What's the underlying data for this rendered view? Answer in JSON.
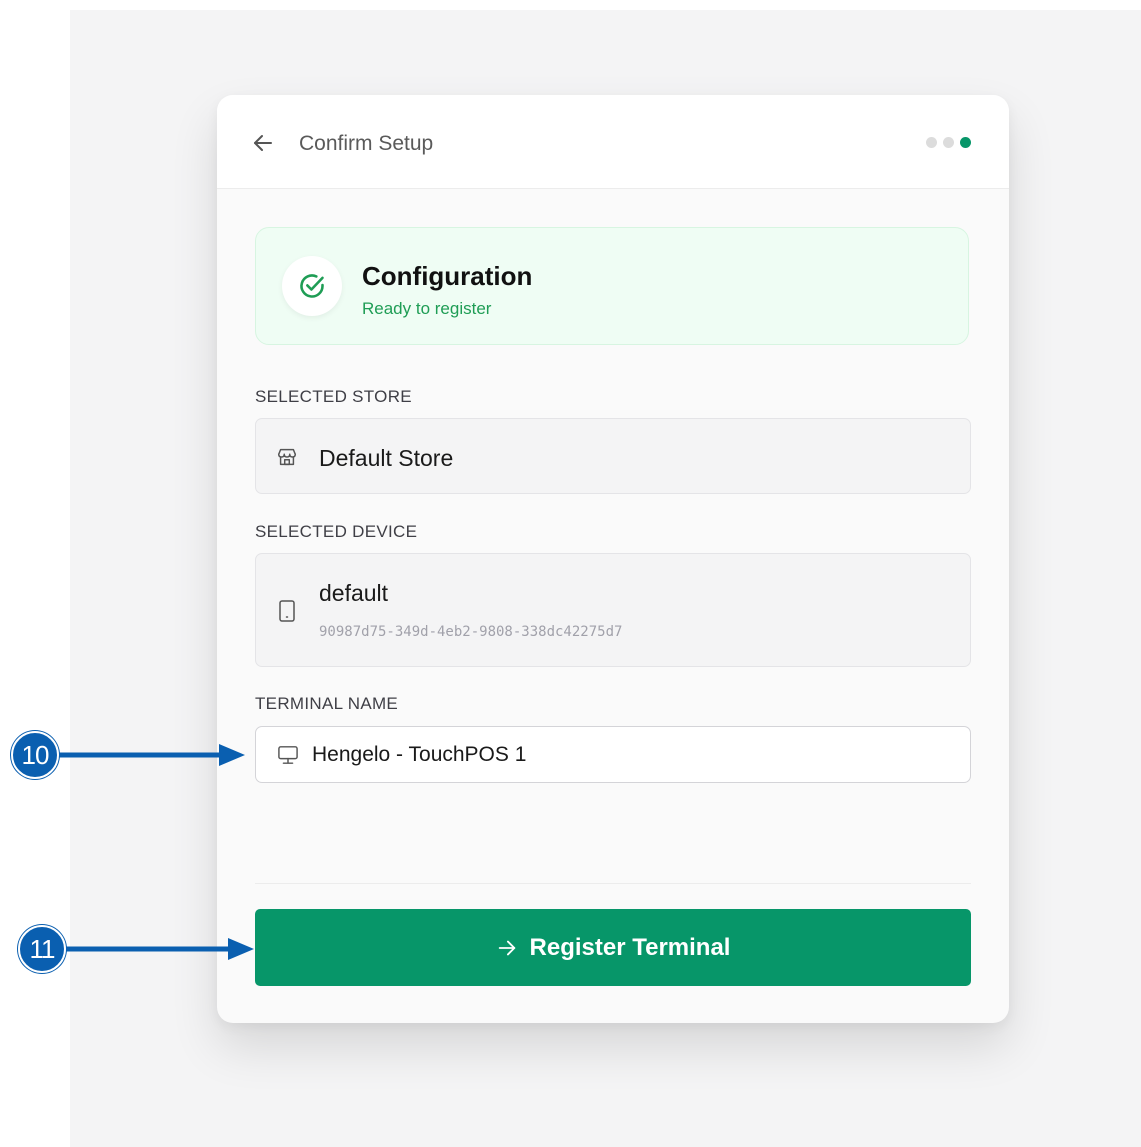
{
  "header": {
    "title": "Confirm Setup",
    "back_icon": "arrow-left-icon",
    "steps_total": 3,
    "steps_active": 3
  },
  "status": {
    "title": "Configuration",
    "subtitle": "Ready to register",
    "icon": "check-circle-icon",
    "accent_color": "#1f9d55"
  },
  "store": {
    "label": "SELECTED STORE",
    "name": "Default Store",
    "icon": "store-icon"
  },
  "device": {
    "label": "SELECTED DEVICE",
    "name": "default",
    "id": "90987d75-349d-4eb2-9808-338dc42275d7",
    "icon": "tablet-icon"
  },
  "terminal": {
    "label": "TERMINAL NAME",
    "value": "Hengelo - TouchPOS 1",
    "icon": "monitor-icon"
  },
  "action": {
    "label": "Register Terminal",
    "icon": "arrow-right-icon",
    "color": "#079669"
  },
  "callouts": [
    {
      "number": "10"
    },
    {
      "number": "11"
    }
  ],
  "colors": {
    "brand": "#079669",
    "callout": "#0a5fb0"
  }
}
